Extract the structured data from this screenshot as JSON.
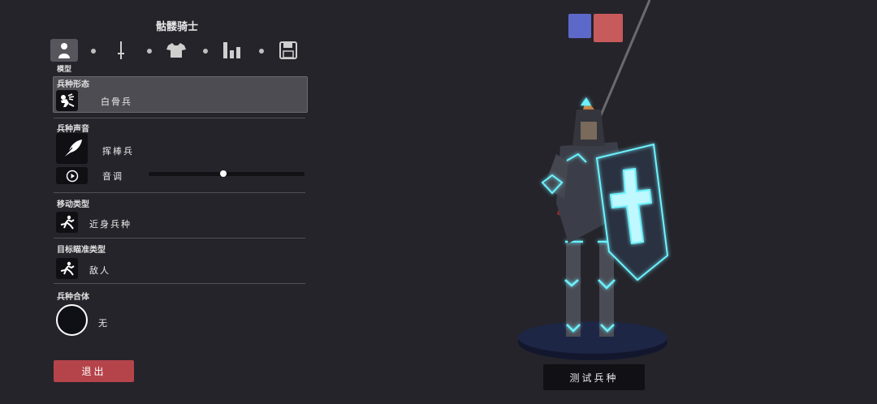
{
  "title": "骷髅骑士",
  "tabs": [
    {
      "icon": "unit-person-icon",
      "active": true
    },
    {
      "icon": "sword-icon",
      "active": false
    },
    {
      "icon": "armor-shirt-icon",
      "active": false
    },
    {
      "icon": "stats-bars-icon",
      "active": false
    },
    {
      "icon": "save-disk-icon",
      "active": false
    }
  ],
  "model_label": "模型",
  "sections": {
    "form": {
      "label": "兵种形态",
      "value": "白骨兵",
      "icon": "skeleton-icon"
    },
    "sound": {
      "label": "兵种声音",
      "value": "挥棒兵",
      "icon": "feather-icon",
      "pitch_label": "音调",
      "pitch_value": 0.48
    },
    "movement": {
      "label": "移动类型",
      "value": "近身兵种",
      "icon": "running-icon"
    },
    "targeting": {
      "label": "目标瞄准类型",
      "value": "敌人",
      "icon": "running-icon"
    },
    "combine": {
      "label": "兵种合体",
      "value": "无"
    }
  },
  "buttons": {
    "exit": "退出",
    "test": "测试兵种"
  },
  "team_colors": {
    "blue": "#5d69c9",
    "red": "#c75a5a"
  },
  "accent_glow": "#6df2ff"
}
